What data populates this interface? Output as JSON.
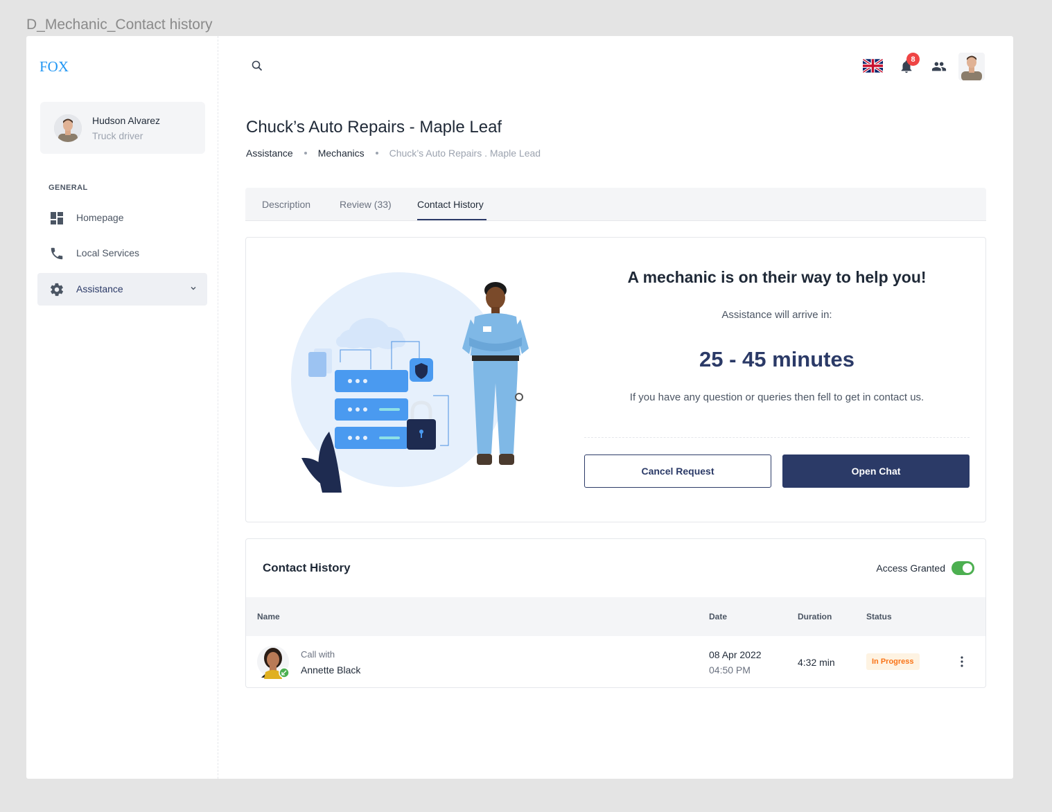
{
  "frame_label": "D_Mechanic_Contact history",
  "sidebar": {
    "logo": "FOX",
    "user": {
      "name": "Hudson Alvarez",
      "role": "Truck driver"
    },
    "section_label": "GENERAL",
    "items": [
      {
        "label": "Homepage",
        "icon": "dashboard-icon"
      },
      {
        "label": "Local Services",
        "icon": "phone-icon"
      },
      {
        "label": "Assistance",
        "icon": "gear-icon",
        "active": true
      }
    ]
  },
  "topbar": {
    "notification_count": "8",
    "icons": [
      "search-icon",
      "uk-flag-icon",
      "bell-icon",
      "people-icon",
      "avatar"
    ]
  },
  "page": {
    "title": "Chuck’s Auto Repairs - Maple Leaf",
    "breadcrumb": [
      "Assistance",
      "Mechanics",
      "Chuck’s Auto Repairs . Maple Lead"
    ]
  },
  "tabs": [
    {
      "label": "Description"
    },
    {
      "label": "Review (33)"
    },
    {
      "label": "Contact History",
      "active": true
    }
  ],
  "status_card": {
    "title": "A mechanic is on their way to help you!",
    "subtitle": "Assistance will arrive in:",
    "eta": "25 - 45 minutes",
    "note": "If you have any question or queries then fell to get in contact us.",
    "cancel_label": "Cancel Request",
    "chat_label": "Open Chat"
  },
  "history": {
    "title": "Contact History",
    "access_label": "Access Granted",
    "access_enabled": true,
    "columns": [
      "Name",
      "Date",
      "Duration",
      "Status"
    ],
    "rows": [
      {
        "prefix": "Call with",
        "name": "Annette Black",
        "date": "08 Apr 2022",
        "time": "04:50 PM",
        "duration": "4:32 min",
        "status": "In Progress"
      }
    ]
  },
  "colors": {
    "primary": "#2b3a67",
    "accent": "#2196f3",
    "toggle_on": "#4caf50",
    "badge": "#ef4444",
    "status_in_progress": "#f97316"
  }
}
